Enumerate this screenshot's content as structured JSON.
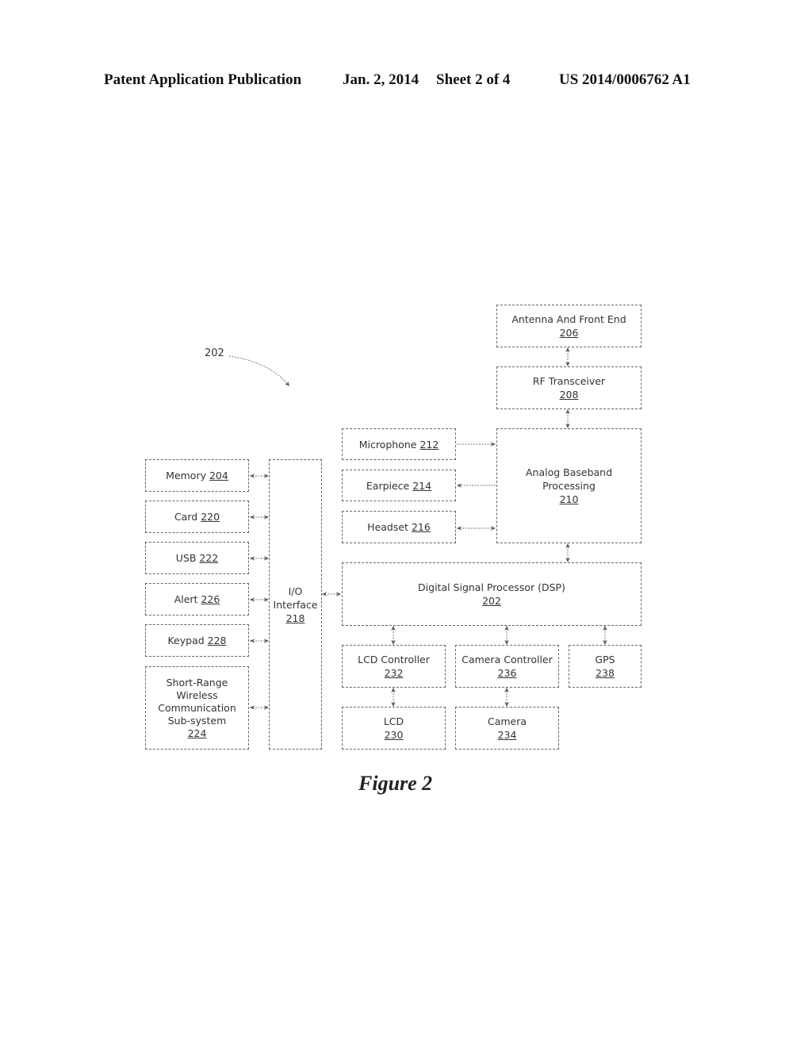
{
  "header": {
    "publication": "Patent Application Publication",
    "date": "Jan. 2, 2014",
    "sheet": "Sheet 2 of 4",
    "number": "US 2014/0006762 A1"
  },
  "reference_label": "202",
  "figure_caption": "Figure 2",
  "blocks": {
    "antenna": {
      "label": "Antenna And Front End",
      "num": "206"
    },
    "rf": {
      "label": "RF Transceiver",
      "num": "208"
    },
    "microphone": {
      "label": "Microphone",
      "num": "212"
    },
    "earpiece": {
      "label": "Earpiece",
      "num": "214"
    },
    "headset": {
      "label": "Headset",
      "num": "216"
    },
    "abb": {
      "label1": "Analog Baseband",
      "label2": "Processing",
      "num": "210"
    },
    "memory": {
      "label": "Memory",
      "num": "204"
    },
    "card": {
      "label": "Card",
      "num": "220"
    },
    "usb": {
      "label": "USB",
      "num": "222"
    },
    "alert": {
      "label": "Alert",
      "num": "226"
    },
    "keypad": {
      "label": "Keypad",
      "num": "228"
    },
    "srw": {
      "label1": "Short-Range",
      "label2": "Wireless",
      "label3": "Communication",
      "label4": "Sub-system",
      "num": "224"
    },
    "io": {
      "label1": "I/O",
      "label2": "Interface",
      "num": "218"
    },
    "dsp": {
      "label": "Digital Signal Processor (DSP)",
      "num": "202"
    },
    "lcdc": {
      "label": "LCD Controller",
      "num": "232"
    },
    "camc": {
      "label": "Camera Controller",
      "num": "236"
    },
    "gps": {
      "label": "GPS",
      "num": "238"
    },
    "lcd": {
      "label": "LCD",
      "num": "230"
    },
    "camera": {
      "label": "Camera",
      "num": "234"
    }
  }
}
